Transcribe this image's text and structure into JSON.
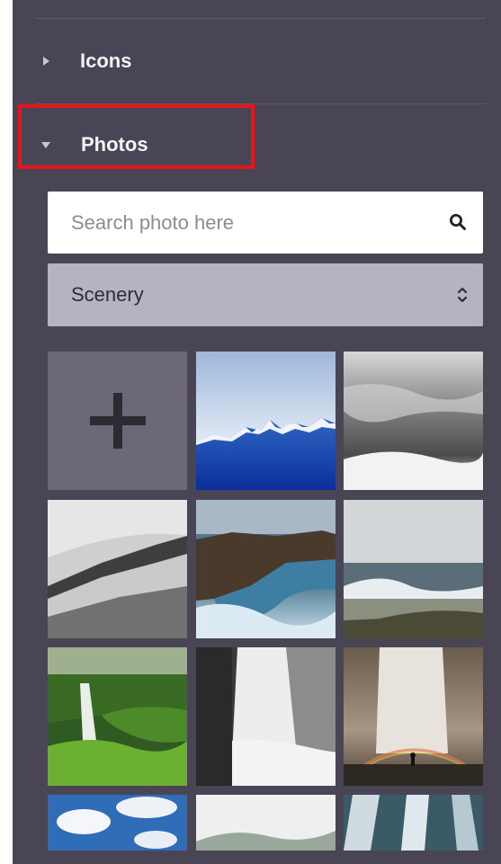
{
  "sections": {
    "icons": {
      "label": "Icons"
    },
    "photos": {
      "label": "Photos"
    }
  },
  "search": {
    "placeholder": "Search photo here",
    "icon": "search-icon"
  },
  "category": {
    "selected": "Scenery",
    "icon": "sort-arrows-icon"
  },
  "colors": {
    "panel": "#4a4554",
    "highlight": "#e8141a",
    "select": "#b6b2c1"
  },
  "photos": [
    {
      "kind": "add",
      "icon": "plus-icon"
    },
    {
      "kind": "photo",
      "subject": "blue-mountains"
    },
    {
      "kind": "photo",
      "subject": "foggy-forest-hills"
    },
    {
      "kind": "photo",
      "subject": "snowy-slope-fog"
    },
    {
      "kind": "photo",
      "subject": "rocky-coast-waves"
    },
    {
      "kind": "photo",
      "subject": "ocean-wave-shore"
    },
    {
      "kind": "photo",
      "subject": "green-waterfall"
    },
    {
      "kind": "photo",
      "subject": "misty-waterfall"
    },
    {
      "kind": "photo",
      "subject": "waterfall-rainbow-person"
    },
    {
      "kind": "photo",
      "subject": "sky-clouds"
    },
    {
      "kind": "photo",
      "subject": "misty-landscape"
    },
    {
      "kind": "photo",
      "subject": "waterfall-rocks"
    }
  ]
}
